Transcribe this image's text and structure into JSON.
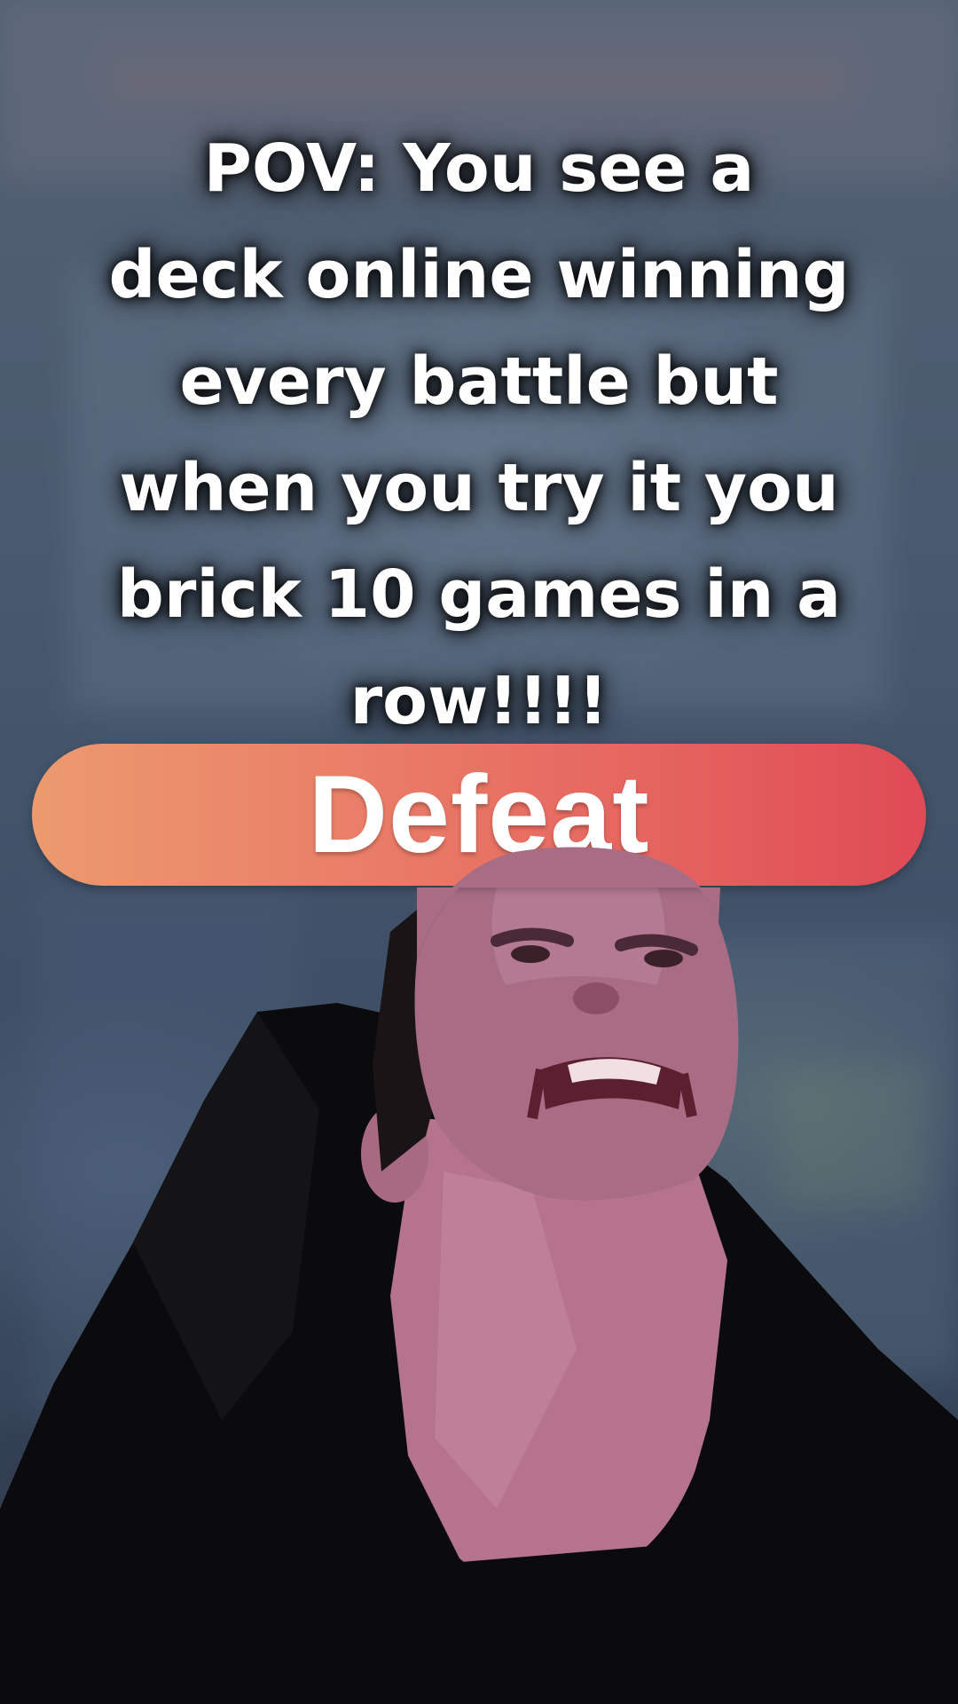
{
  "caption": {
    "text": "POV: You see a\ndeck online winning\nevery battle but\nwhen you try it you\nbrick 10 games in a\nrow!!!!"
  },
  "banner": {
    "label": "Defeat",
    "gradient_start": "#ec9a6e",
    "gradient_end": "#df4a55"
  },
  "subject": {
    "description": "person-cutout"
  }
}
